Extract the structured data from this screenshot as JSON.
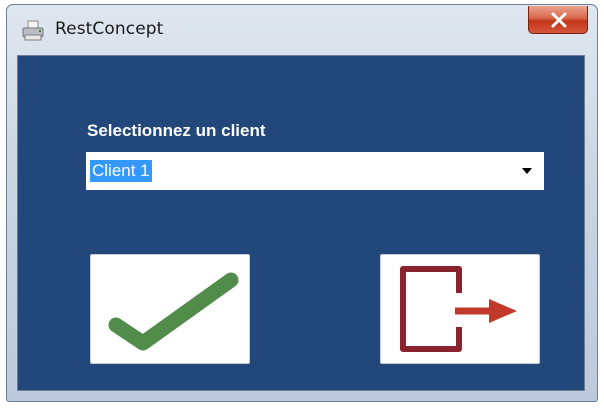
{
  "window": {
    "title": "RestConcept",
    "app_icon": "printer-icon",
    "close_icon": "close-icon"
  },
  "form": {
    "client_label": "Selectionnez un client",
    "client_select": {
      "selected": "Client 1",
      "dropdown_icon": "dropdown-arrow-icon"
    }
  },
  "buttons": {
    "confirm": {
      "icon": "checkmark-icon",
      "color": "#528c4a"
    },
    "exit": {
      "icon": "exit-door-icon",
      "color": "#8a2330",
      "arrow_color": "#c0392b"
    }
  },
  "colors": {
    "background": "#22487b",
    "selection": "#3399ff",
    "close_button": "#c2371b"
  }
}
